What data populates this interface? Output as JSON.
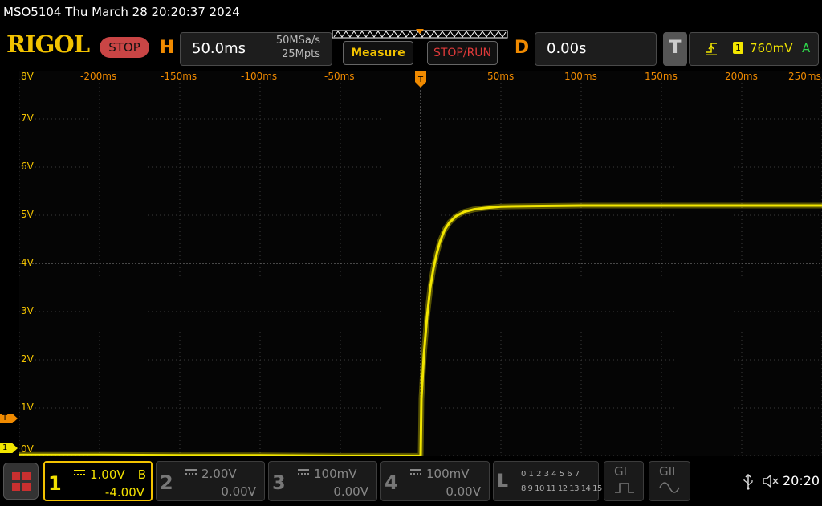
{
  "title": "MSO5104  Thu March 28 20:20:37 2024",
  "toolbar": {
    "logo": "RIGOL",
    "run_status": "STOP",
    "horizontal": {
      "tag": "H",
      "timebase": "50.0ms",
      "sample_rate": "50MSa/s",
      "memory_depth": "25Mpts"
    },
    "measure_label": "Measure",
    "stop_run_label": "STOP/RUN",
    "delay": {
      "tag": "D",
      "value": "0.00s"
    },
    "trigger": {
      "tag": "T",
      "source": "1",
      "level": "760mV",
      "mode": "A"
    }
  },
  "plot": {
    "x_tick_labels": [
      "-200ms",
      "-150ms",
      "-100ms",
      "-50ms",
      "50ms",
      "100ms",
      "150ms",
      "200ms",
      "250ms"
    ],
    "y_tick_labels": [
      "8V",
      "7V",
      "6V",
      "5V",
      "4V",
      "3V",
      "2V",
      "1V",
      "0V"
    ],
    "trigger_marker": "T",
    "channel_marker": "1"
  },
  "channels": [
    {
      "num": "1",
      "scale": "1.00V",
      "offset": "-4.00V",
      "bw": "B"
    },
    {
      "num": "2",
      "scale": "2.00V",
      "offset": "0.00V"
    },
    {
      "num": "3",
      "scale": "100mV",
      "offset": "0.00V"
    },
    {
      "num": "4",
      "scale": "100mV",
      "offset": "0.00V"
    }
  ],
  "logic": {
    "tag": "L",
    "row1": "0 1 2 3  4 5 6 7",
    "row2": "8 9 10 11 12 13 14 15"
  },
  "generators": {
    "g1": "GI",
    "g2": "GII"
  },
  "clock": "20:20",
  "colors": {
    "ch1": "#f2e600",
    "accent": "#f08a00",
    "stop": "#c94545"
  },
  "chart_data": {
    "type": "line",
    "series": [
      {
        "x": [
          -250,
          -200,
          -150,
          -100,
          -50,
          -5,
          0,
          0.5,
          2,
          4,
          6,
          8,
          10,
          12,
          15,
          18,
          22,
          27,
          33,
          40,
          50,
          70,
          100,
          150,
          200,
          250
        ],
        "y": [
          0.03,
          0.03,
          0.02,
          0.02,
          0.01,
          0.01,
          0.01,
          1.2,
          2.1,
          2.9,
          3.5,
          3.9,
          4.2,
          4.45,
          4.7,
          4.85,
          4.98,
          5.07,
          5.12,
          5.15,
          5.18,
          5.19,
          5.2,
          5.2,
          5.2,
          5.2
        ]
      }
    ],
    "xlim": [
      -250,
      250
    ],
    "ylim": [
      0,
      8
    ],
    "grid": true
  }
}
